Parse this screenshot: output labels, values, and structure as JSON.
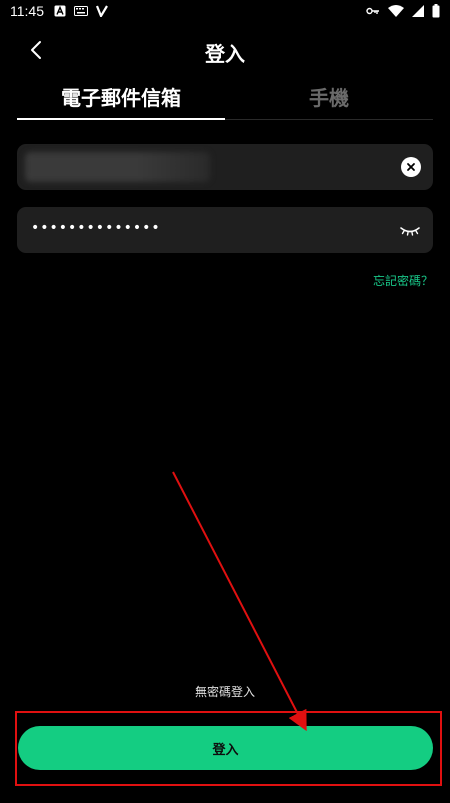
{
  "status_bar": {
    "time": "11:45",
    "left_icons": [
      "a-notification-icon",
      "keyboard-icon",
      "v-app-icon"
    ],
    "right_icons": [
      "key-icon",
      "wifi-icon",
      "signal-icon",
      "battery-icon"
    ]
  },
  "header": {
    "title": "登入",
    "back_icon": "back-chevron-icon"
  },
  "tabs": [
    {
      "label": "電子郵件信箱",
      "active": true
    },
    {
      "label": "手機",
      "active": false
    }
  ],
  "form": {
    "email_value": "",
    "password_value": "••••••••••••••",
    "forgot_password": "忘記密碼？"
  },
  "passwordless_login": "無密碼登入",
  "login_button": "登入",
  "colors": {
    "accent": "#14cd82",
    "link": "#19c98a",
    "annotation": "#e01010",
    "background": "#000000",
    "field_bg": "#1f1f1f"
  }
}
